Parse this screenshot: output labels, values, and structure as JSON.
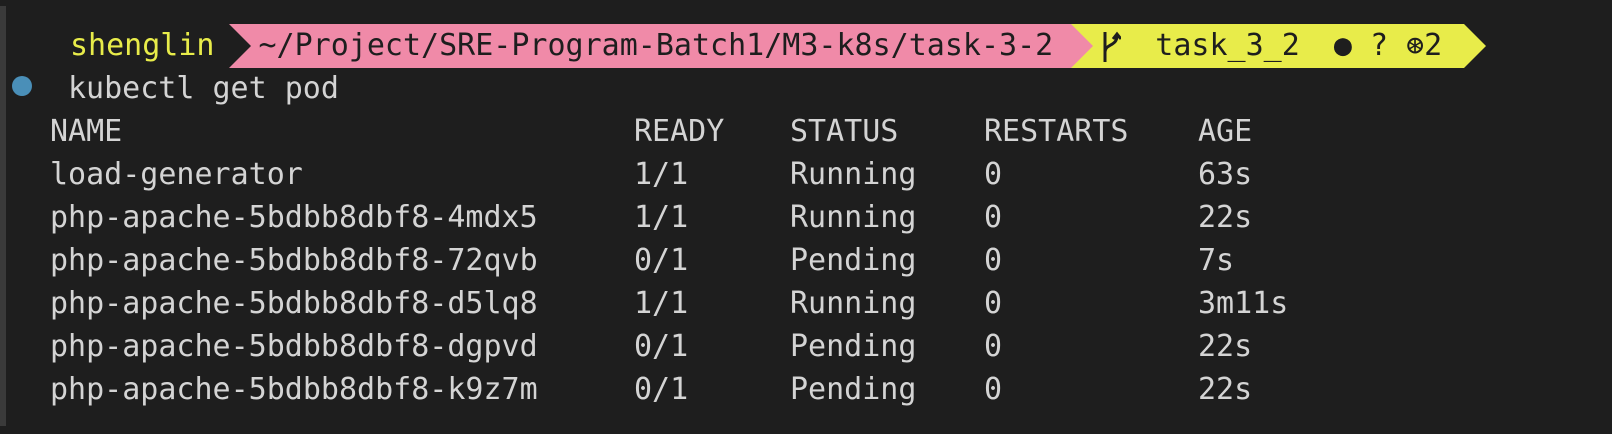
{
  "prompt": {
    "user": "shenglin",
    "path": "~/Project/SRE-Program-Batch1/M3-k8s/task-3-2",
    "branch_icon": "git-branch-icon",
    "branch": "task_3_2",
    "git_status": "● ? ⊛2"
  },
  "command": "kubectl get pod",
  "table": {
    "headers": [
      "NAME",
      "READY",
      "STATUS",
      "RESTARTS",
      "AGE"
    ],
    "rows": [
      [
        "load-generator",
        "1/1",
        "Running",
        "0",
        "63s"
      ],
      [
        "php-apache-5bdbb8dbf8-4mdx5",
        "1/1",
        "Running",
        "0",
        "22s"
      ],
      [
        "php-apache-5bdbb8dbf8-72qvb",
        "0/1",
        "Pending",
        "0",
        "7s"
      ],
      [
        "php-apache-5bdbb8dbf8-d5lq8",
        "1/1",
        "Running",
        "0",
        "3m11s"
      ],
      [
        "php-apache-5bdbb8dbf8-dgpvd",
        "0/1",
        "Pending",
        "0",
        "22s"
      ],
      [
        "php-apache-5bdbb8dbf8-k9z7m",
        "0/1",
        "Pending",
        "0",
        "22s"
      ]
    ]
  },
  "colors": {
    "background": "#1e1e1e",
    "text": "#d4d4d4",
    "user_fg": "#e8ec4a",
    "path_bg": "#f08aa8",
    "git_bg": "#e8ec4a",
    "status_dot": "#4a8fb8"
  }
}
